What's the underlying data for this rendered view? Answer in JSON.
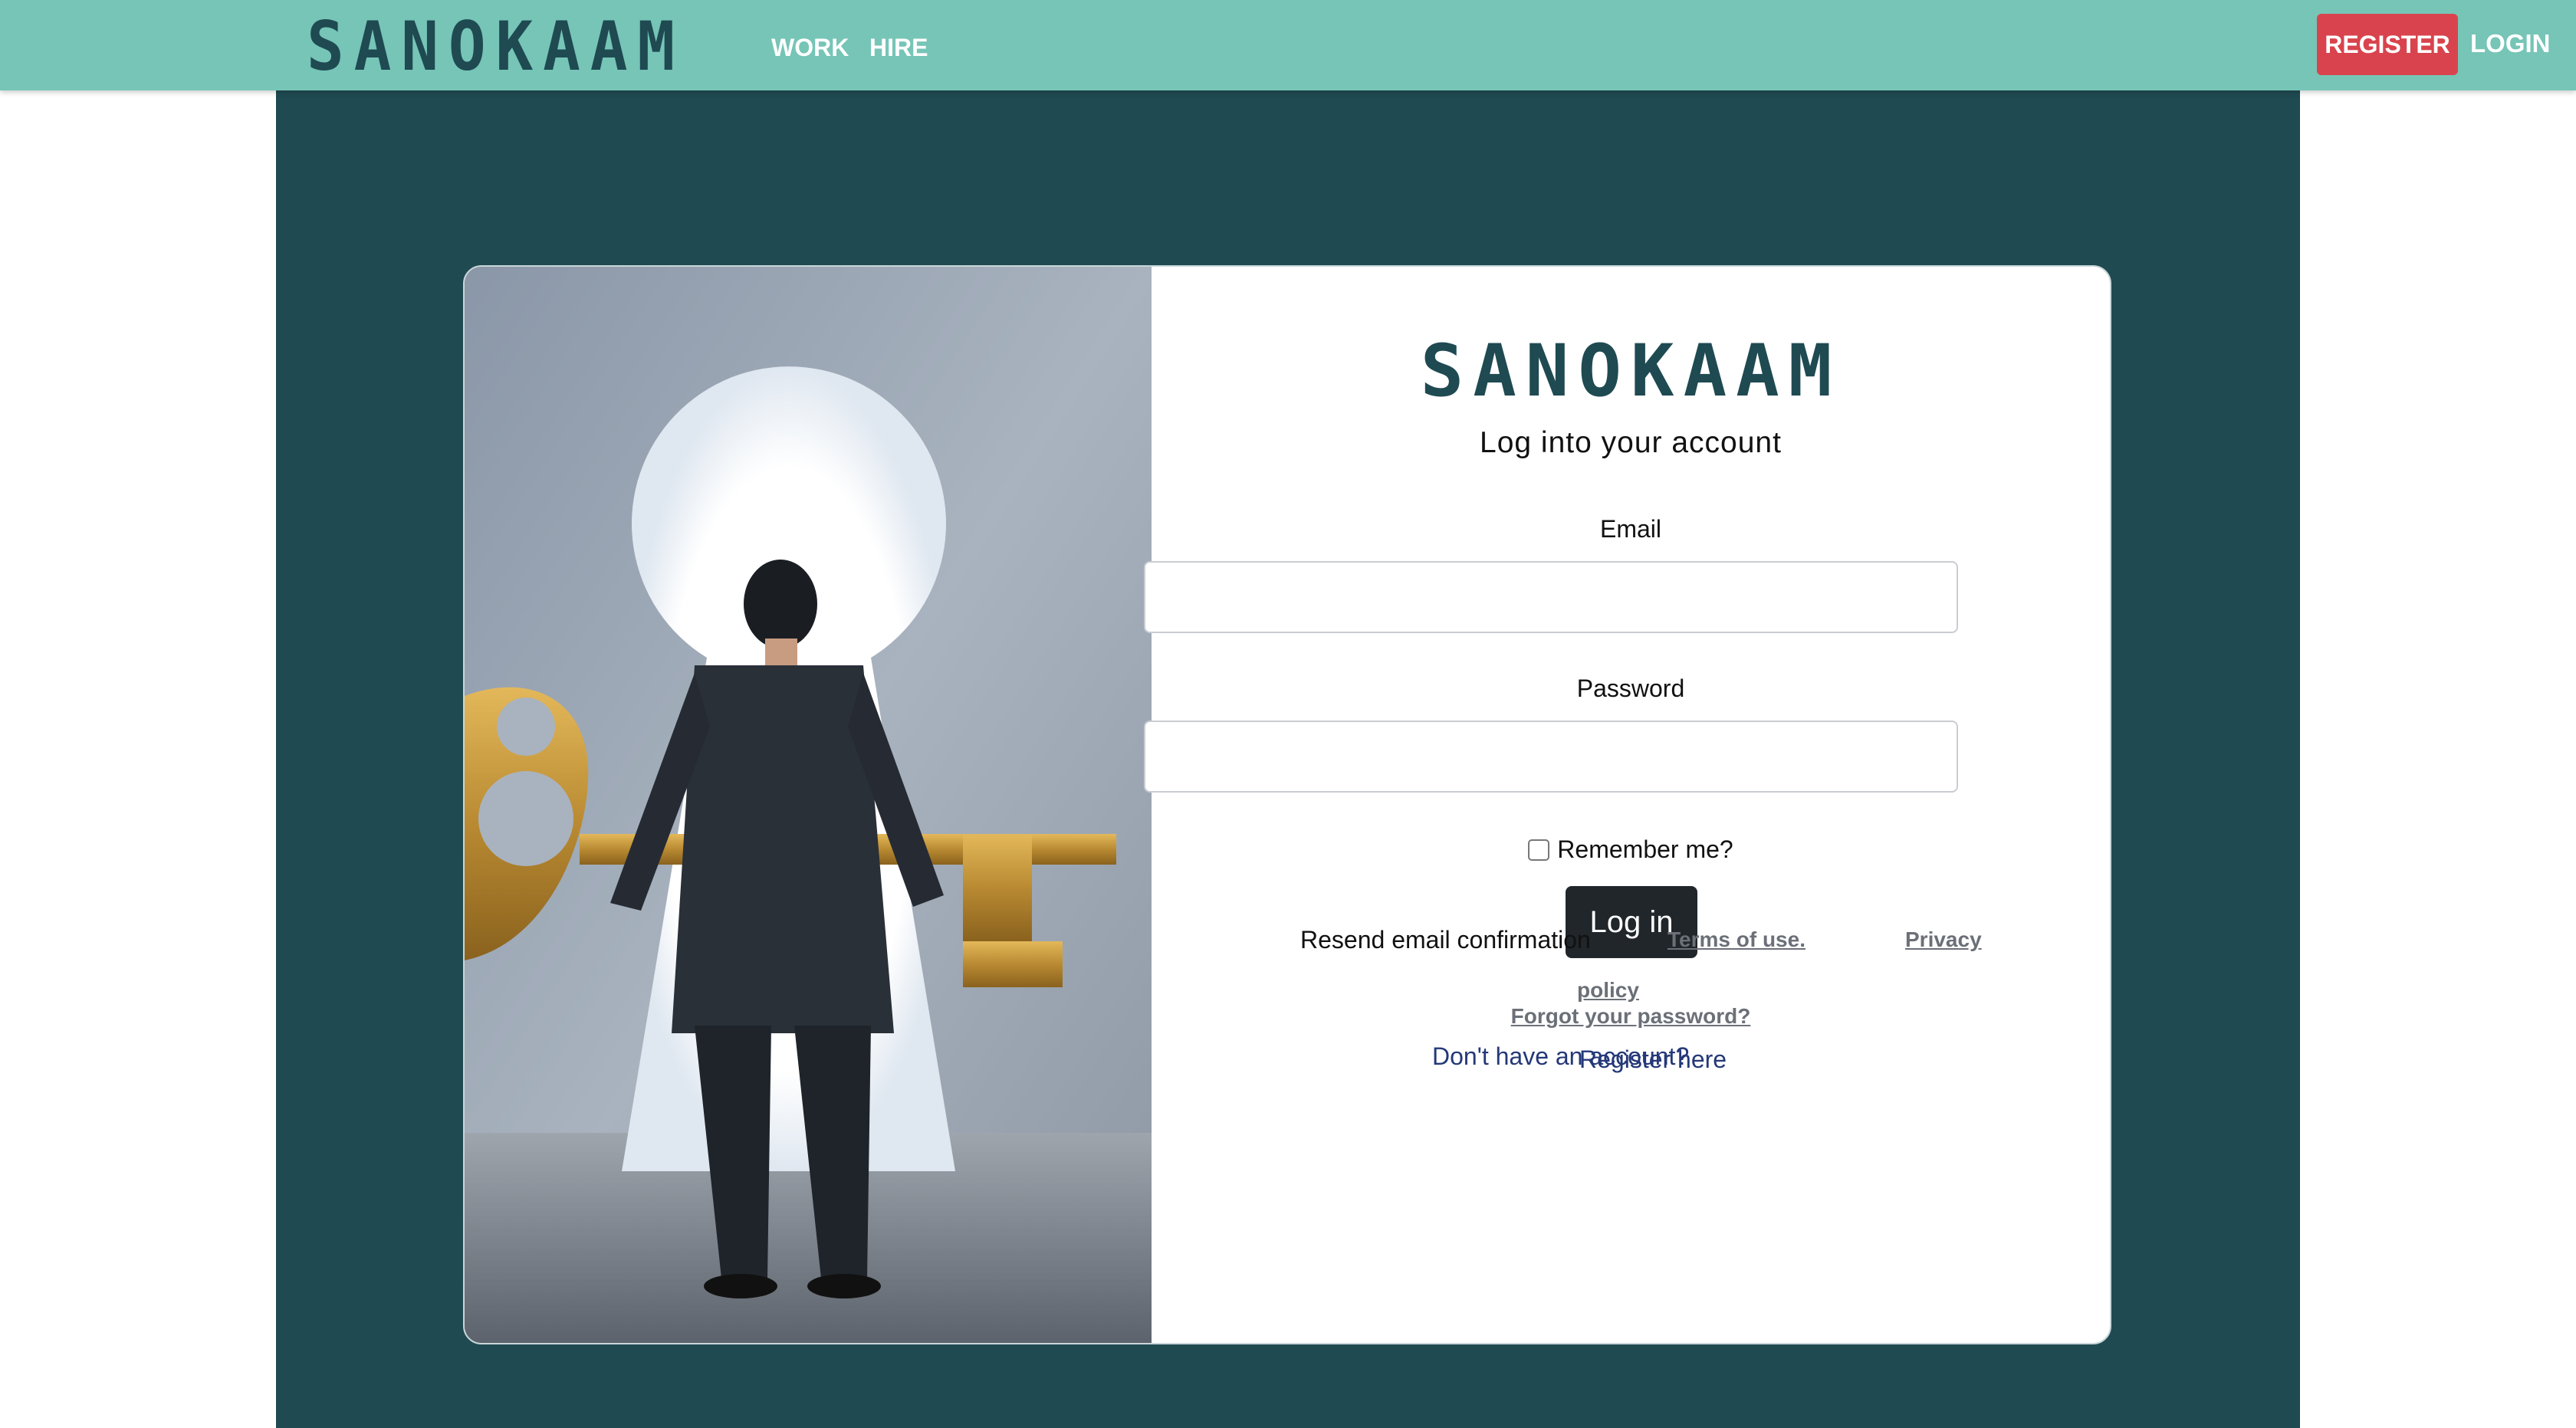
{
  "navbar": {
    "brand": "SANOKAAM",
    "links": [
      "WORK",
      "HIRE"
    ],
    "register_label": "REGISTER",
    "login_label": "LOGIN"
  },
  "form": {
    "logo": "SANOKAAM",
    "subtitle": "Log into your account",
    "email_label": "Email",
    "email_value": "",
    "password_label": "Password",
    "password_value": "",
    "remember_label": "Remember me?",
    "login_button": "Log in",
    "forgot_link": "Forgot your password?",
    "no_account_text": "Don't have an account?",
    "register_link": "Register here"
  },
  "footer": {
    "resend": "Resend email confirmation",
    "terms": "Terms of use.",
    "privacy": "Privacy",
    "policy": "policy"
  },
  "colors": {
    "navbar": "#76c5b7",
    "brand": "#1f4a52",
    "main_bg": "#1f4a52",
    "register_button": "#d9434d",
    "login_button": "#21262b",
    "link": "#243878"
  }
}
